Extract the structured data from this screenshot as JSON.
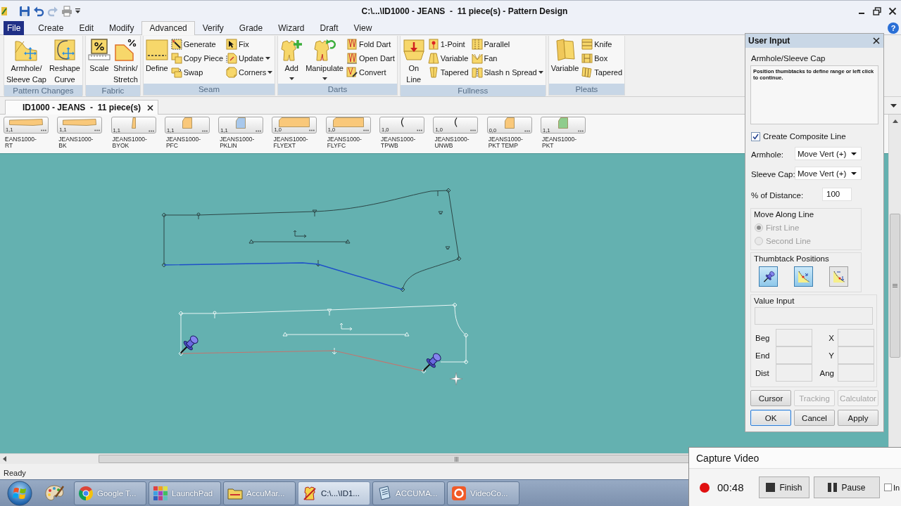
{
  "title_bar": {
    "title": "C:\\...\\ID1000 - JEANS  -  11 piece(s) - Pattern Design"
  },
  "menu": {
    "tabs": [
      {
        "label": "File",
        "kind": "application",
        "selected": false
      },
      {
        "label": "Create",
        "kind": "tab",
        "selected": false
      },
      {
        "label": "Edit",
        "kind": "tab",
        "selected": false
      },
      {
        "label": "Modify",
        "kind": "tab",
        "selected": false
      },
      {
        "label": "Advanced",
        "kind": "tab",
        "selected": true
      },
      {
        "label": "Verify",
        "kind": "tab",
        "selected": false
      },
      {
        "label": "Grade",
        "kind": "tab",
        "selected": false
      },
      {
        "label": "Wizard",
        "kind": "tab",
        "selected": false
      },
      {
        "label": "Draft",
        "kind": "tab",
        "selected": false
      },
      {
        "label": "View",
        "kind": "tab",
        "selected": false
      }
    ],
    "help": "?"
  },
  "ribbon": {
    "groups": [
      {
        "label": "Pattern Changes",
        "items": [
          {
            "label": "Armhole/\nSleeve Cap",
            "kind": "large",
            "dropdown": false
          },
          {
            "label": "Reshape\nCurve",
            "kind": "large",
            "dropdown": false
          }
        ]
      },
      {
        "label": "Fabric",
        "items": [
          {
            "label": "Scale",
            "kind": "large",
            "dropdown": false
          },
          {
            "label": "Shrink/\nStretch",
            "kind": "large",
            "dropdown": false
          }
        ]
      },
      {
        "label": "Seam",
        "items": [
          {
            "label": "Define",
            "kind": "large",
            "dropdown": false
          },
          {
            "label": "Generate",
            "kind": "small",
            "dropdown": false
          },
          {
            "label": "Copy Piece",
            "kind": "small",
            "dropdown": false
          },
          {
            "label": "Swap",
            "kind": "small",
            "dropdown": false
          },
          {
            "label": "Fix",
            "kind": "small",
            "dropdown": false
          },
          {
            "label": "Update",
            "kind": "small",
            "dropdown": true
          },
          {
            "label": "Corners",
            "kind": "small",
            "dropdown": true
          }
        ]
      },
      {
        "label": "Darts",
        "items": [
          {
            "label": "Add",
            "kind": "large",
            "dropdown": true
          },
          {
            "label": "Manipulate",
            "kind": "large",
            "dropdown": true
          },
          {
            "label": "Fold Dart",
            "kind": "small",
            "dropdown": false
          },
          {
            "label": "Open Dart",
            "kind": "small",
            "dropdown": false
          },
          {
            "label": "Convert",
            "kind": "small",
            "dropdown": false
          }
        ]
      },
      {
        "label": "Fullness",
        "items": [
          {
            "label": "On\nLine",
            "kind": "large",
            "dropdown": false
          },
          {
            "label": "1-Point",
            "kind": "small",
            "dropdown": false
          },
          {
            "label": "Variable",
            "kind": "small",
            "dropdown": false
          },
          {
            "label": "Tapered",
            "kind": "small",
            "dropdown": false
          },
          {
            "label": "Parallel",
            "kind": "small",
            "dropdown": false
          },
          {
            "label": "Fan",
            "kind": "small",
            "dropdown": false
          },
          {
            "label": "Slash n Spread",
            "kind": "small",
            "dropdown": true
          }
        ]
      },
      {
        "label": "Pleats",
        "items": [
          {
            "label": "Variable",
            "kind": "large",
            "dropdown": false
          },
          {
            "label": "Knife",
            "kind": "small",
            "dropdown": false
          },
          {
            "label": "Box",
            "kind": "small",
            "dropdown": false
          },
          {
            "label": "Tapered",
            "kind": "small",
            "dropdown": false
          }
        ]
      }
    ]
  },
  "document_tabs": [
    {
      "label": "ID1000 - JEANS  -  11 piece(s)",
      "selected": true
    }
  ],
  "piece_strip": {
    "pieces": [
      {
        "name": "EANS1000-RT",
        "grade": "1,1",
        "kind": "long",
        "color": "#f9c87a"
      },
      {
        "name": "JEANS1000-BK",
        "grade": "1,1",
        "kind": "long",
        "color": "#f9c87a"
      },
      {
        "name": "JEANS1000-BYOK",
        "grade": "1,1",
        "kind": "strip",
        "color": "#f9c87a"
      },
      {
        "name": "JEANS1000-PFC",
        "grade": "1,1",
        "kind": "pocket",
        "color": "#f9c87a"
      },
      {
        "name": "JEANS1000-PKLIN",
        "grade": "1,1",
        "kind": "pocket",
        "color": "#a8c8ec"
      },
      {
        "name": "JEANS1000-FLYEXT",
        "grade": "1,0",
        "kind": "block",
        "color": "#f9c87a"
      },
      {
        "name": "JEANS1000-FLYFC",
        "grade": "1,0",
        "kind": "block",
        "color": "#f9c87a"
      },
      {
        "name": "JEANS1000-TPWB",
        "grade": "1,0",
        "kind": "curve"
      },
      {
        "name": "JEANS1000-UNWB",
        "grade": "1,0",
        "kind": "curve"
      },
      {
        "name": "JEANS1000-PKT TEMP",
        "grade": "0,0",
        "kind": "pocket",
        "color": "#f9c87a"
      },
      {
        "name": "JEANS1000-PKT",
        "grade": "1,1",
        "kind": "pocket",
        "color": "#8fcc8c"
      }
    ]
  },
  "user_input": {
    "title": "User Input",
    "tool": "Armhole/Sleeve Cap",
    "message": "Position thumbtacks to define range or left click to continue.",
    "composite_line": {
      "label": "Create Composite Line",
      "checked": true
    },
    "fields": [
      {
        "label": "Armhole:",
        "kind": "dropdown",
        "value": "Move Vert (+)"
      },
      {
        "label": "Sleeve Cap:",
        "kind": "dropdown",
        "value": "Move Vert (+)"
      },
      {
        "label": "% of Distance:",
        "kind": "text",
        "value": "100"
      }
    ],
    "move_along_line": {
      "title": "Move Along Line",
      "options": [
        {
          "label": "First Line",
          "selected": true,
          "disabled": true
        },
        {
          "label": "Second Line",
          "selected": false,
          "disabled": true
        }
      ]
    },
    "thumbtack_positions": {
      "title": "Thumbtack Positions",
      "buttons": [
        {
          "selected": true
        },
        {
          "selected": true
        },
        {
          "selected": false
        }
      ]
    },
    "value_input": {
      "title": "Value Input",
      "fields": [
        {
          "label": "Beg"
        },
        {
          "label": "X"
        },
        {
          "label": "End"
        },
        {
          "label": "Y"
        },
        {
          "label": "Dist"
        },
        {
          "label": "Ang"
        }
      ]
    },
    "buttons": [
      {
        "label": "Cursor",
        "disabled": false,
        "focused": false
      },
      {
        "label": "Tracking",
        "disabled": true,
        "focused": false
      },
      {
        "label": "Calculator",
        "disabled": true,
        "focused": false
      },
      {
        "label": "OK",
        "disabled": false,
        "focused": true
      },
      {
        "label": "Cancel",
        "disabled": false,
        "focused": false
      },
      {
        "label": "Apply",
        "disabled": false,
        "focused": false
      }
    ]
  },
  "status_bar": {
    "text": "Ready"
  },
  "taskbar": {
    "items": [
      {
        "label": "Google T...",
        "selected": false
      },
      {
        "label": "LaunchPad",
        "selected": false
      },
      {
        "label": "AccuMar...",
        "selected": false
      },
      {
        "label": "C:\\...\\ID1...",
        "selected": true
      },
      {
        "label": "ACCUMA...",
        "selected": false
      },
      {
        "label": "VideoCo...",
        "selected": false
      }
    ]
  },
  "capture_video": {
    "title": "Capture Video",
    "recording": true,
    "time": "00:48",
    "buttons": [
      {
        "label": "Finish",
        "kind": "stop"
      },
      {
        "label": "Pause",
        "kind": "pause"
      }
    ],
    "checkbox": {
      "label": "In",
      "checked": false
    }
  }
}
